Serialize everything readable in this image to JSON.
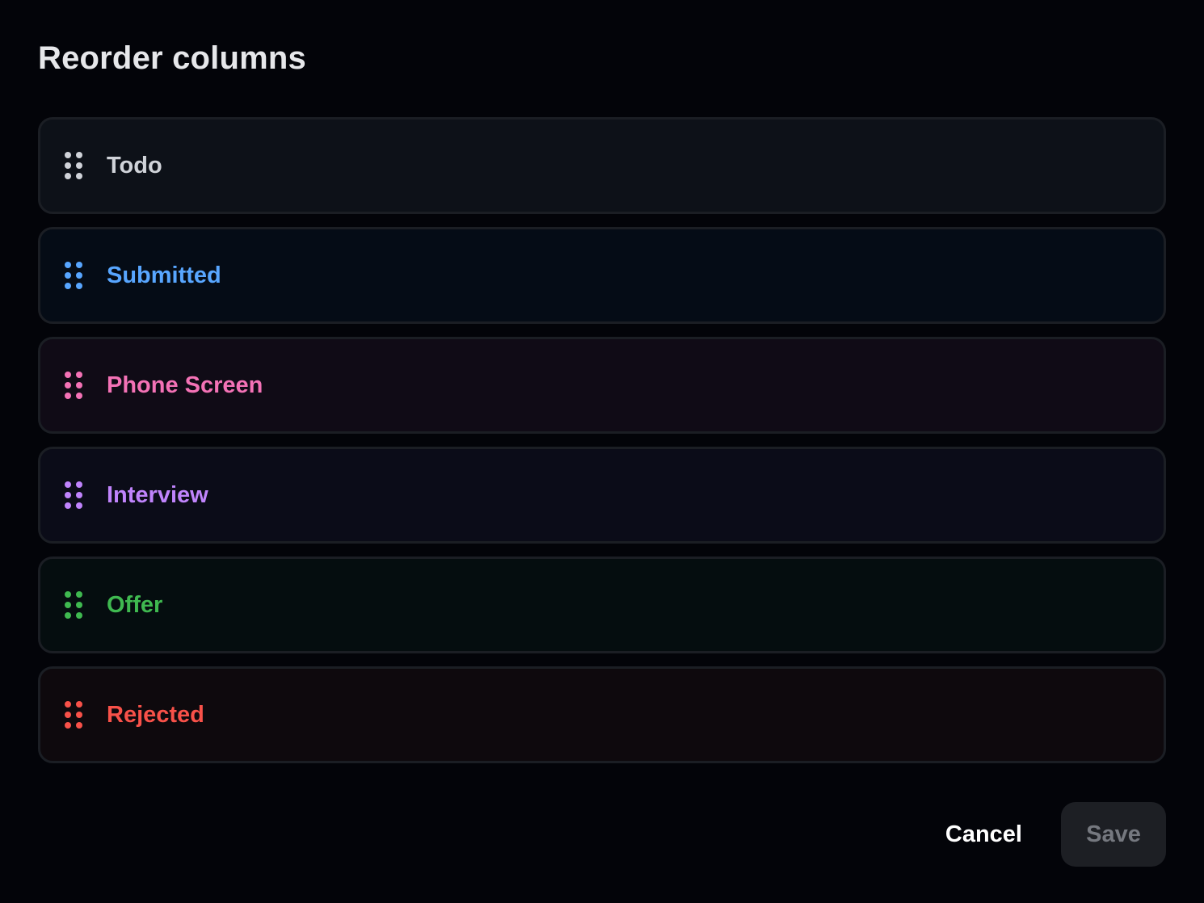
{
  "dialog": {
    "title": "Reorder columns"
  },
  "columns": [
    {
      "label": "Todo",
      "color": "#d0d3d9",
      "bg": "#0d1118"
    },
    {
      "label": "Submitted",
      "color": "#58a6ff",
      "bg": "#050c16"
    },
    {
      "label": "Phone Screen",
      "color": "#f472b6",
      "bg": "#100b16"
    },
    {
      "label": "Interview",
      "color": "#c084fc",
      "bg": "#0b0c18"
    },
    {
      "label": "Offer",
      "color": "#3fb950",
      "bg": "#050d0f"
    },
    {
      "label": "Rejected",
      "color": "#f85149",
      "bg": "#0e090d"
    }
  ],
  "footer": {
    "cancel_label": "Cancel",
    "save_label": "Save"
  },
  "icons": {
    "drag_handle": "grip-vertical-icon"
  }
}
